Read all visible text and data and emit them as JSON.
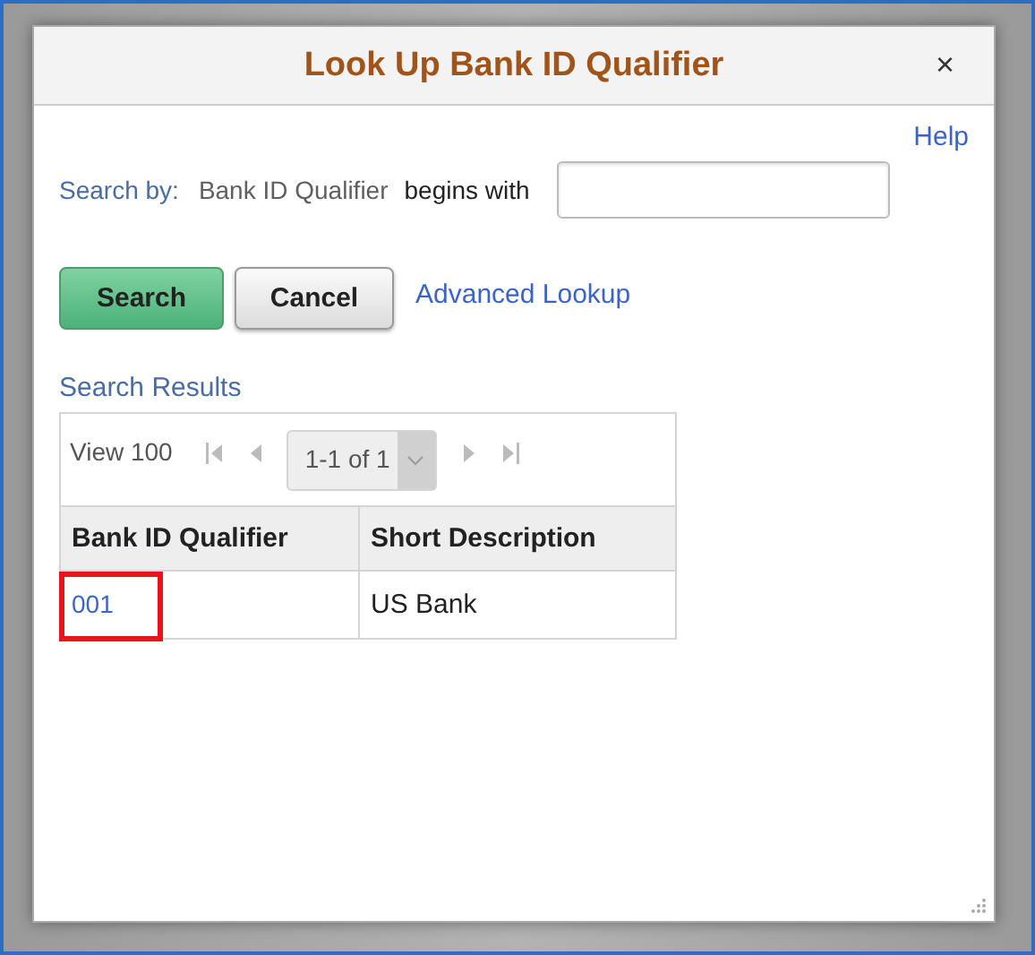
{
  "dialog": {
    "title": "Look Up Bank ID Qualifier",
    "close": "×",
    "help": "Help"
  },
  "search": {
    "label": "Search by:",
    "field": "Bank ID Qualifier",
    "operator": "begins with"
  },
  "buttons": [
    {
      "label": "Search",
      "kind": "primary"
    },
    {
      "label": "Cancel",
      "kind": "secondary"
    }
  ],
  "advanced_link": "Advanced Lookup",
  "results": {
    "title": "Search Results",
    "view": "View 100",
    "range": "1-1 of 1",
    "columns": [
      "Bank ID Qualifier",
      "Short Description"
    ],
    "rows": [
      {
        "cells": [
          "001",
          "US Bank"
        ],
        "highlighted": true
      }
    ]
  }
}
